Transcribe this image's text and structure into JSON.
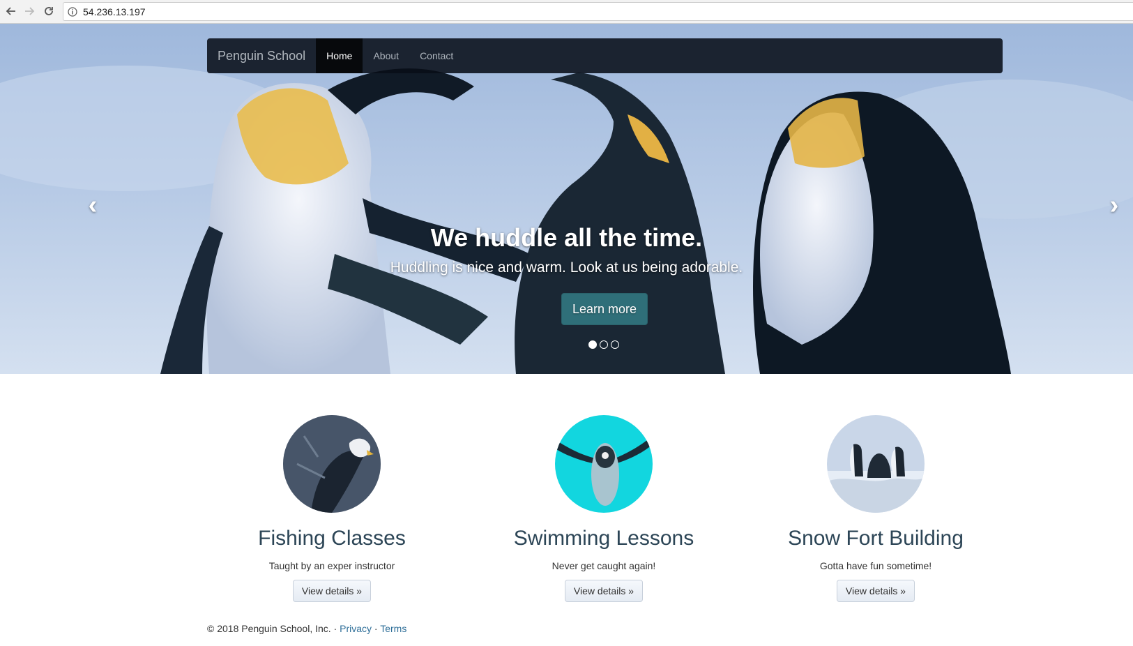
{
  "browser": {
    "url": "54.236.13.197"
  },
  "navbar": {
    "brand": "Penguin School",
    "links": [
      {
        "label": "Home",
        "active": true
      },
      {
        "label": "About",
        "active": false
      },
      {
        "label": "Contact",
        "active": false
      }
    ]
  },
  "carousel": {
    "heading": "We huddle all the time.",
    "text": "Huddling is nice and warm. Look at us being adorable.",
    "button_label": "Learn more",
    "prev_icon": "chevron-left-icon",
    "next_icon": "chevron-right-icon",
    "slide_count": 3,
    "active_slide": 1
  },
  "features": [
    {
      "title": "Fishing Classes",
      "text": "Taught by an exper instructor",
      "button_label": "View details »",
      "image": "eagle-photo"
    },
    {
      "title": "Swimming Lessons",
      "text": "Never get caught again!",
      "button_label": "View details »",
      "image": "swimming-penguin-photo"
    },
    {
      "title": "Snow Fort Building",
      "text": "Gotta have fun sometime!",
      "button_label": "View details »",
      "image": "penguins-in-snow-photo"
    }
  ],
  "footer": {
    "copyright": "© 2018 Penguin School, Inc. · ",
    "privacy": "Privacy",
    "separator": " · ",
    "terms": "Terms"
  },
  "colors": {
    "accent": "#2f6f79",
    "link": "#2f6f99",
    "heading": "#2c4556"
  }
}
